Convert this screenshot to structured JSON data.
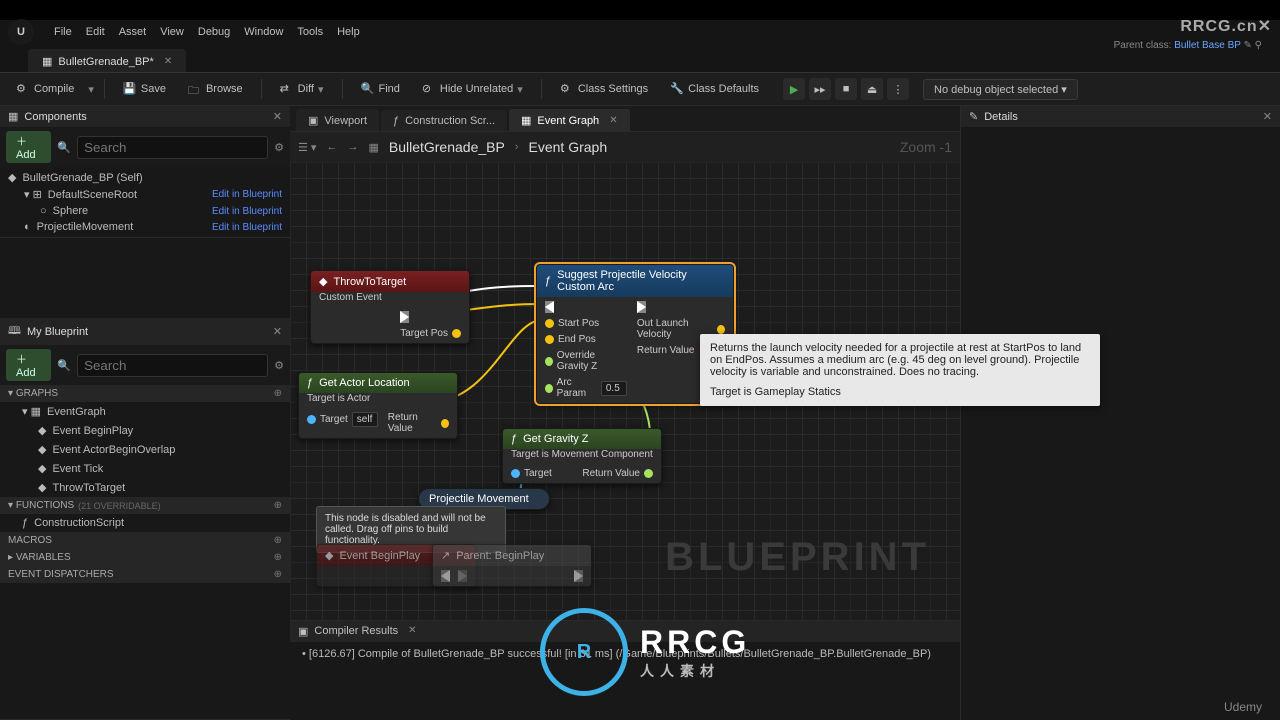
{
  "watermark_tr": "RRCG.cn✕",
  "menubar": {
    "items": [
      "File",
      "Edit",
      "Asset",
      "View",
      "Debug",
      "Window",
      "Tools",
      "Help"
    ]
  },
  "parent_class": {
    "prefix": "Parent class:",
    "link": "Bullet Base BP"
  },
  "tab": {
    "label": "BulletGrenade_BP*"
  },
  "toolbar": {
    "compile": "Compile",
    "save": "Save",
    "browse": "Browse",
    "diff": "Diff",
    "find": "Find",
    "hide": "Hide Unrelated",
    "class_settings": "Class Settings",
    "class_defaults": "Class Defaults",
    "debug_select": "No debug object selected ▾"
  },
  "components_panel": {
    "title": "Components",
    "add": "Add",
    "search_ph": "Search",
    "rows": [
      {
        "label": "BulletGrenade_BP (Self)",
        "indent": 0,
        "link": ""
      },
      {
        "label": "DefaultSceneRoot",
        "indent": 1,
        "link": "Edit in Blueprint"
      },
      {
        "label": "Sphere",
        "indent": 2,
        "link": "Edit in Blueprint"
      },
      {
        "label": "ProjectileMovement",
        "indent": 1,
        "link": "Edit in Blueprint"
      }
    ]
  },
  "myblueprint": {
    "title": "My Blueprint",
    "add": "Add",
    "search_ph": "Search",
    "sections": {
      "graphs": {
        "header": "GRAPHS",
        "items": [
          "EventGraph",
          "Event BeginPlay",
          "Event ActorBeginOverlap",
          "Event Tick",
          "ThrowToTarget"
        ]
      },
      "functions": {
        "header": "FUNCTIONS",
        "suffix": "(21 OVERRIDABLE)",
        "items": [
          "ConstructionScript"
        ]
      },
      "macros": {
        "header": "MACROS",
        "items": []
      },
      "variables": {
        "header": "VARIABLES",
        "items": []
      },
      "dispatchers": {
        "header": "EVENT DISPATCHERS",
        "items": []
      }
    }
  },
  "inner_tabs": {
    "viewport": "Viewport",
    "construction": "Construction Scr...",
    "event_graph": "Event Graph"
  },
  "breadcrumb": {
    "item": "BulletGrenade_BP",
    "leaf": "Event Graph",
    "zoom": "Zoom  -1"
  },
  "nodes": {
    "throw": {
      "title": "ThrowToTarget",
      "sub": "Custom Event",
      "out_exec": "",
      "pin_target_pos": "Target Pos"
    },
    "getactor": {
      "title": "Get Actor Location",
      "sub": "Target is Actor",
      "pin_target": "Target",
      "pin_self": "self",
      "pin_return": "Return Value"
    },
    "suggest": {
      "title": "Suggest Projectile Velocity Custom Arc",
      "pins_left": [
        "Start Pos",
        "End Pos",
        "Override Gravity Z",
        "Arc Param"
      ],
      "arc_param_val": "0.5",
      "pins_right": [
        "Out Launch Velocity",
        "Return Value"
      ]
    },
    "getgrav": {
      "title": "Get Gravity Z",
      "sub": "Target is Movement Component",
      "pin_target": "Target",
      "pin_return": "Return Value"
    },
    "projmov": {
      "title": "Projectile Movement"
    },
    "disabled_info": "This node is disabled and will not be called. Drag off pins to build functionality.",
    "beginplay": {
      "title": "Event BeginPlay"
    },
    "parentbegin": {
      "title": "Parent: BeginPlay"
    }
  },
  "tooltip": {
    "body": "Returns the launch velocity needed for a projectile at rest at StartPos to land on EndPos. Assumes a medium arc (e.g. 45 deg on level ground). Projectile velocity is variable and unconstrained. Does no tracing.",
    "target": "Target is Gameplay Statics"
  },
  "graph_wm": "BLUEPRINT",
  "compiler": {
    "title": "Compiler Results",
    "line": "[6126.67] Compile of BulletGrenade_BP successful! [in 31 ms] (/Game/Blueprints/Bullets/BulletGrenade_BP.BulletGrenade_BP)"
  },
  "details": {
    "title": "Details"
  },
  "logo": {
    "big": "RRCG",
    "sm": "人人素材"
  },
  "udemy": "Udemy"
}
